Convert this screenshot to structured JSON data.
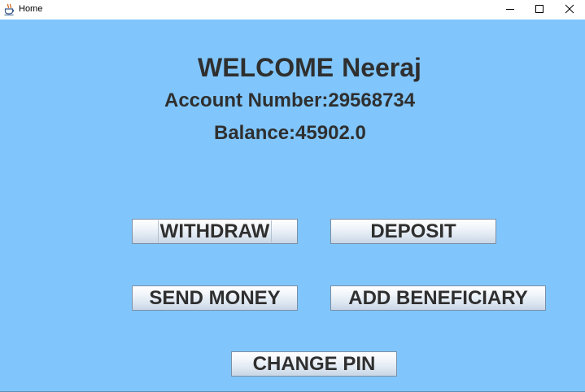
{
  "window": {
    "title": "Home",
    "app_icon": "java-cup-icon",
    "controls": {
      "minimize": "minimize-icon",
      "maximize": "maximize-icon",
      "close": "close-icon"
    }
  },
  "colors": {
    "background": "#80c6fc",
    "text": "#2f2f2f"
  },
  "header": {
    "welcome": "WELCOME",
    "user_name": "Neeraj",
    "account_label": "Account Number:",
    "account_number": "29568734",
    "balance_label": "Balance:",
    "balance_value": "45902.0"
  },
  "actions": {
    "withdraw": "WITHDRAW",
    "deposit": "DEPOSIT",
    "send_money": "SEND MONEY",
    "add_beneficiary": "ADD BENEFICIARY",
    "change_pin": "CHANGE PIN"
  }
}
